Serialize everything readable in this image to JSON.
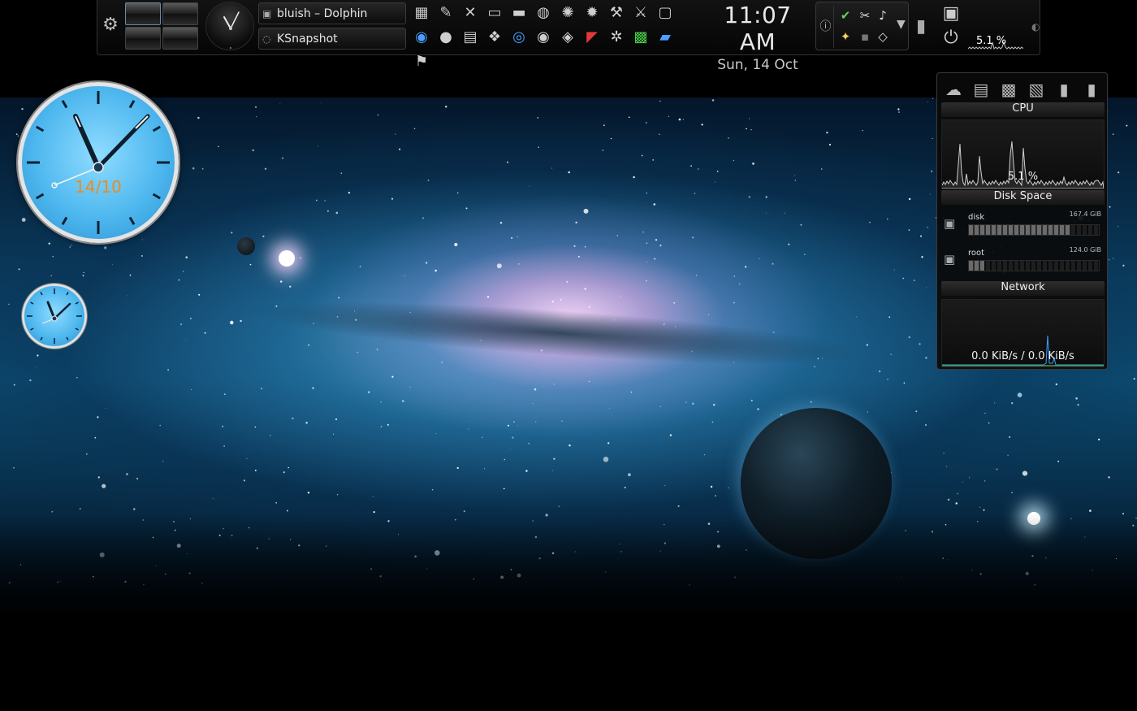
{
  "panel": {
    "tasks": [
      {
        "icon": "dolphin-icon",
        "label": "bluish – Dolphin"
      },
      {
        "icon": "ksnapshot-icon",
        "label": "KSnapshot"
      }
    ],
    "launchers_row1": [
      "package-icon",
      "pencil-icon",
      "tools-icon",
      "window-icon",
      "folder-icon",
      "disc-icon",
      "splat-icon",
      "settings-icon",
      "hammer-icon",
      "wrench-icon",
      "screen-icon",
      "globe-icon"
    ],
    "launchers_row2": [
      "circle-icon",
      "mask-icon",
      "apps-icon",
      "mc-icon",
      "eye-icon",
      "alien-icon",
      "flag-icon",
      "satellite-icon",
      "monitor-icon",
      "boxes-icon",
      "map-pin-icon"
    ],
    "clock": {
      "time": "11:07 AM",
      "date": "Sun, 14 Oct"
    },
    "mini_cpu": "5.1 %"
  },
  "big_clock": {
    "date": "14/10",
    "accent": "#f08a1a"
  },
  "sysmon": {
    "cpu": {
      "title": "CPU",
      "value": "5.1 %"
    },
    "disk": {
      "title": "Disk Space",
      "items": [
        {
          "name": "disk",
          "size": "167.4 GiB",
          "used_fraction": 0.78
        },
        {
          "name": "root",
          "size": "124.0 GiB",
          "used_fraction": 0.12
        }
      ]
    },
    "network": {
      "title": "Network",
      "value": "0.0 KiB/s / 0.0 KiB/s"
    }
  },
  "colors": {
    "accent_blue": "#4fb8ef",
    "graph_line": "#d0d0d0",
    "net_line": "#3aa0ff"
  }
}
